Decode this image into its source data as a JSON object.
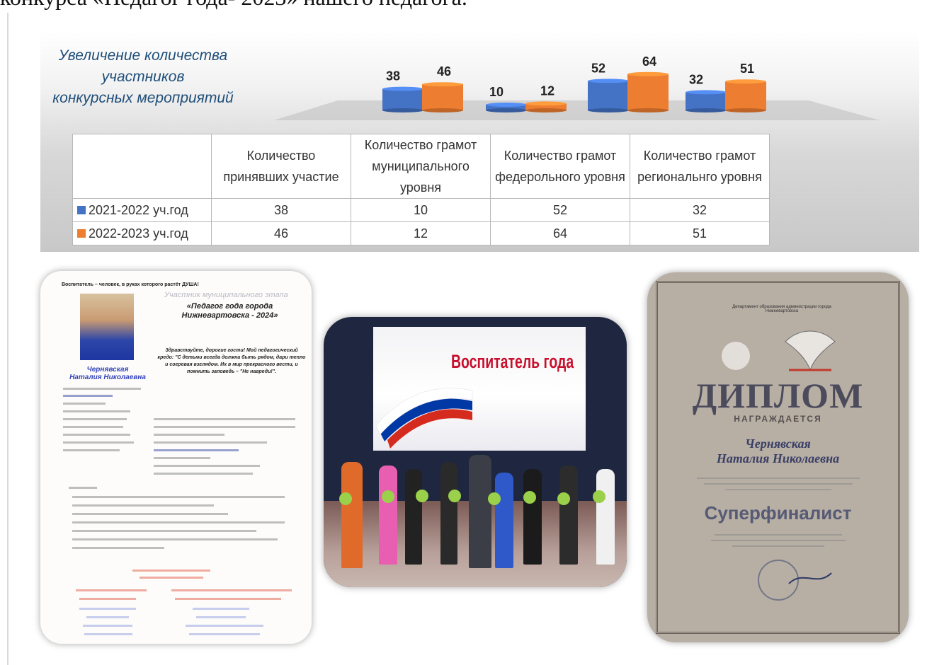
{
  "top_text": "конкурса «Педагог года- 2023» нашего педагога.",
  "chart_data": {
    "type": "bar",
    "title": [
      "Увеличение количества",
      "участников",
      "конкурсных мероприятий"
    ],
    "categories": [
      "Количество принявших участие",
      "Количество грамот муниципального уровня",
      "Количество грамот федерольного уровня",
      "Количество грамот региональнго уровня"
    ],
    "series": [
      {
        "name": "2021-2022 уч.год",
        "values": [
          38,
          10,
          52,
          32
        ],
        "color": "#4472c4"
      },
      {
        "name": "2022-2023 уч.год",
        "values": [
          46,
          12,
          64,
          51
        ],
        "color": "#ed7d31"
      }
    ],
    "ylim": [
      0,
      70
    ],
    "legend": "table-left",
    "grid": false
  },
  "table": {
    "headers": [
      "",
      "Количество принявших участие",
      "Количество грамот муниципального уровня",
      "Количество грамот федерольного уровня",
      "Количество грамот региональнго уровня"
    ]
  },
  "photo1": {
    "header": "Воспитатель – человек, в руках которого растёт ДУША!",
    "subtitle": "Участник муниципального этапа",
    "title": "«Педагог года города Нижневартовска - 2024»",
    "name": [
      "Чернявская",
      "Наталия Николаевна"
    ],
    "greeting": "Здравствуйте, дорогие гости! Мой педагогический кредо: \"С детьми всегда должна быть рядом, дари тепло и согревая взглядом. Их в мир прекрасного вести, и помнить заповедь – \"Не навреди!\"."
  },
  "photo2": {
    "screen_text": "Воспитатель года"
  },
  "photo3": {
    "header": "Департамент образования администрации города Нижневартовска",
    "title": "ДИПЛОМ",
    "award": "НАГРАЖДАЕТСЯ",
    "name": [
      "Чернявская",
      "Наталия Николаевна"
    ],
    "result": "Суперфиналист"
  }
}
